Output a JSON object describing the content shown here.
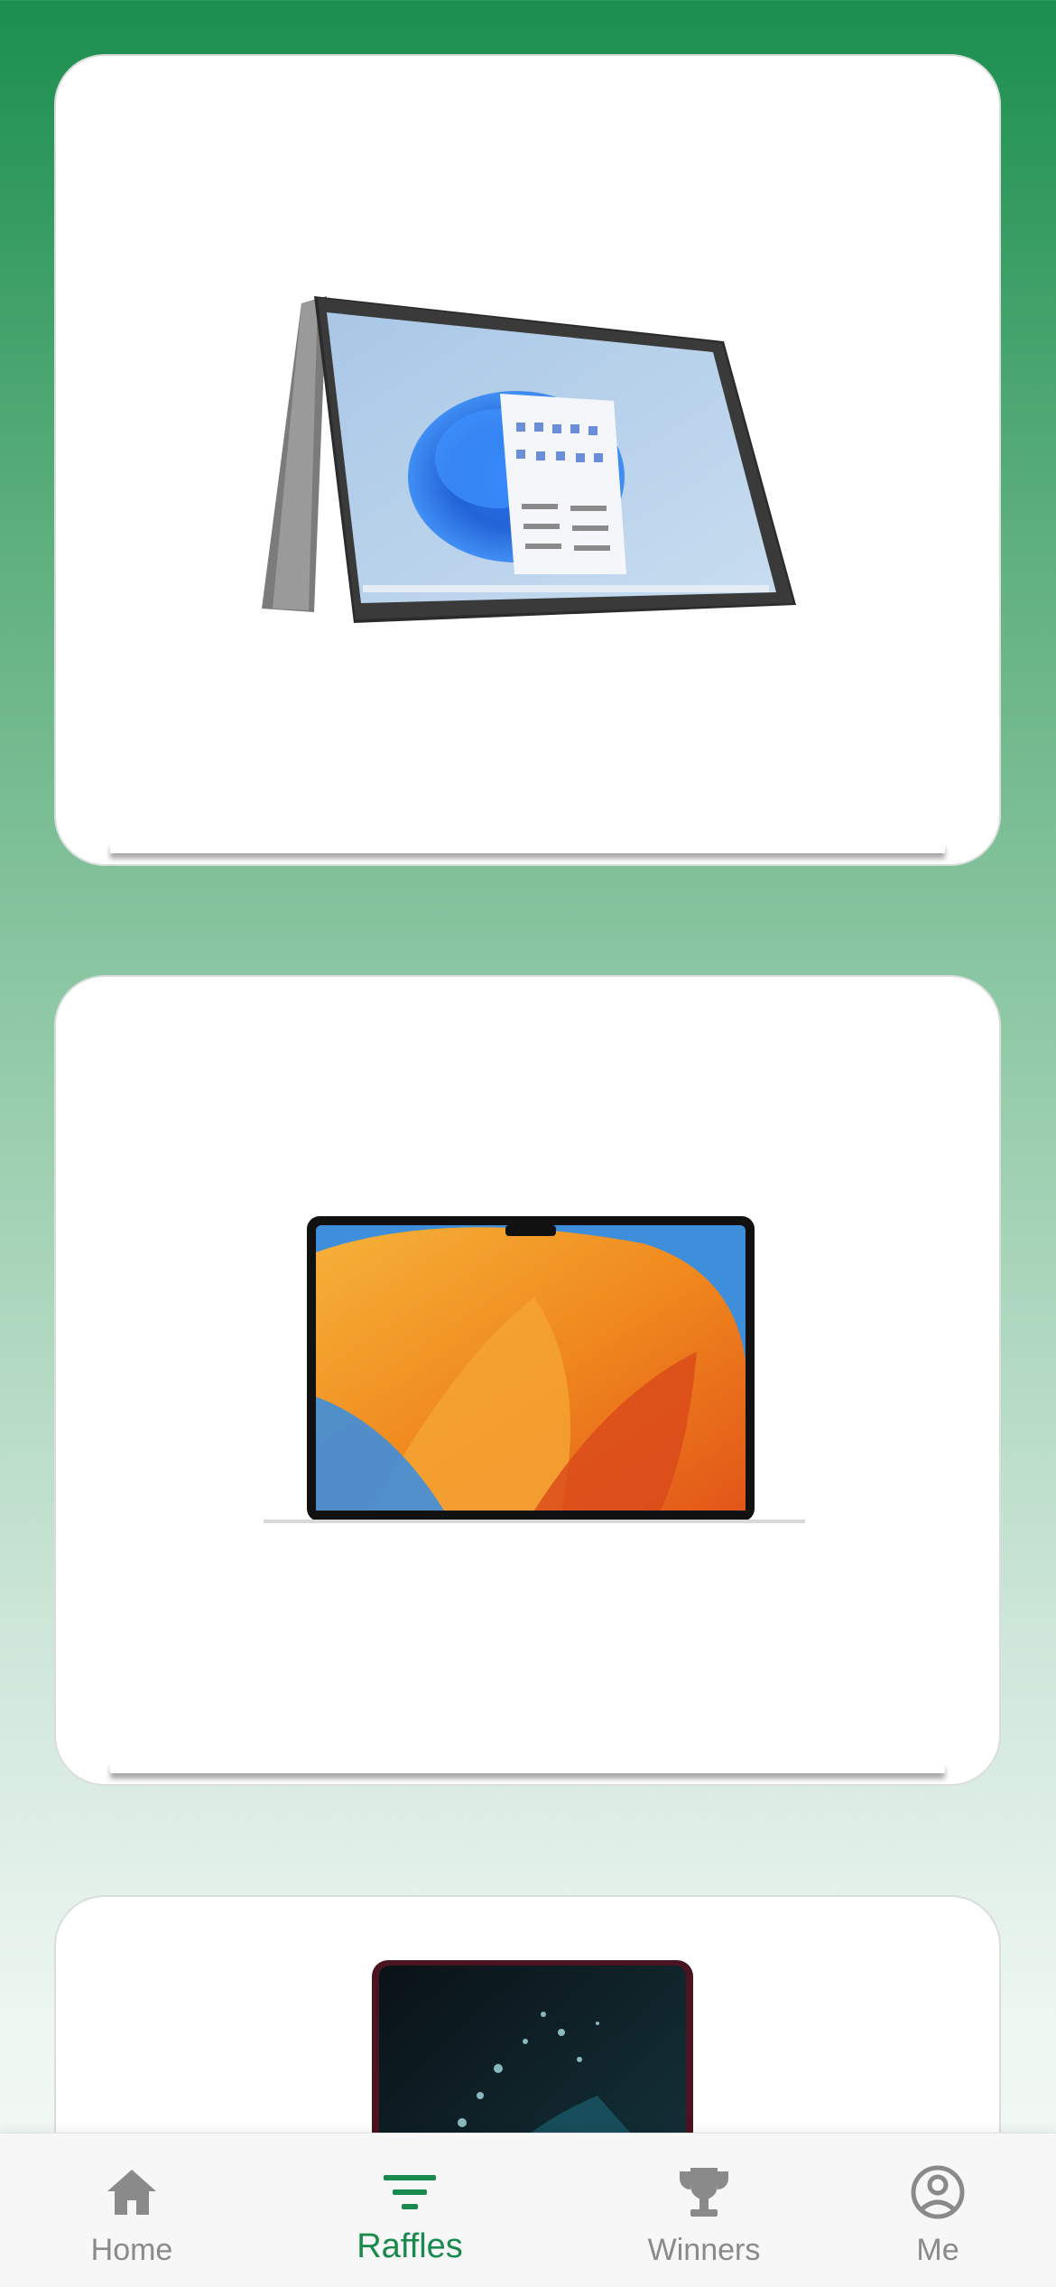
{
  "tabbar": {
    "tabs": [
      {
        "label": "Home",
        "icon": "home-icon",
        "active": false
      },
      {
        "label": "Raffles",
        "icon": "filter-icon",
        "active": true
      },
      {
        "label": "Winners",
        "icon": "trophy-icon",
        "active": false
      },
      {
        "label": "Me",
        "icon": "account-icon",
        "active": false
      }
    ]
  },
  "colors": {
    "accent": "#198a4e",
    "inactive": "#8a8a8a",
    "background_top": "#1b8f4f",
    "background_bottom": "#f6faf8",
    "card": "#ffffff"
  }
}
